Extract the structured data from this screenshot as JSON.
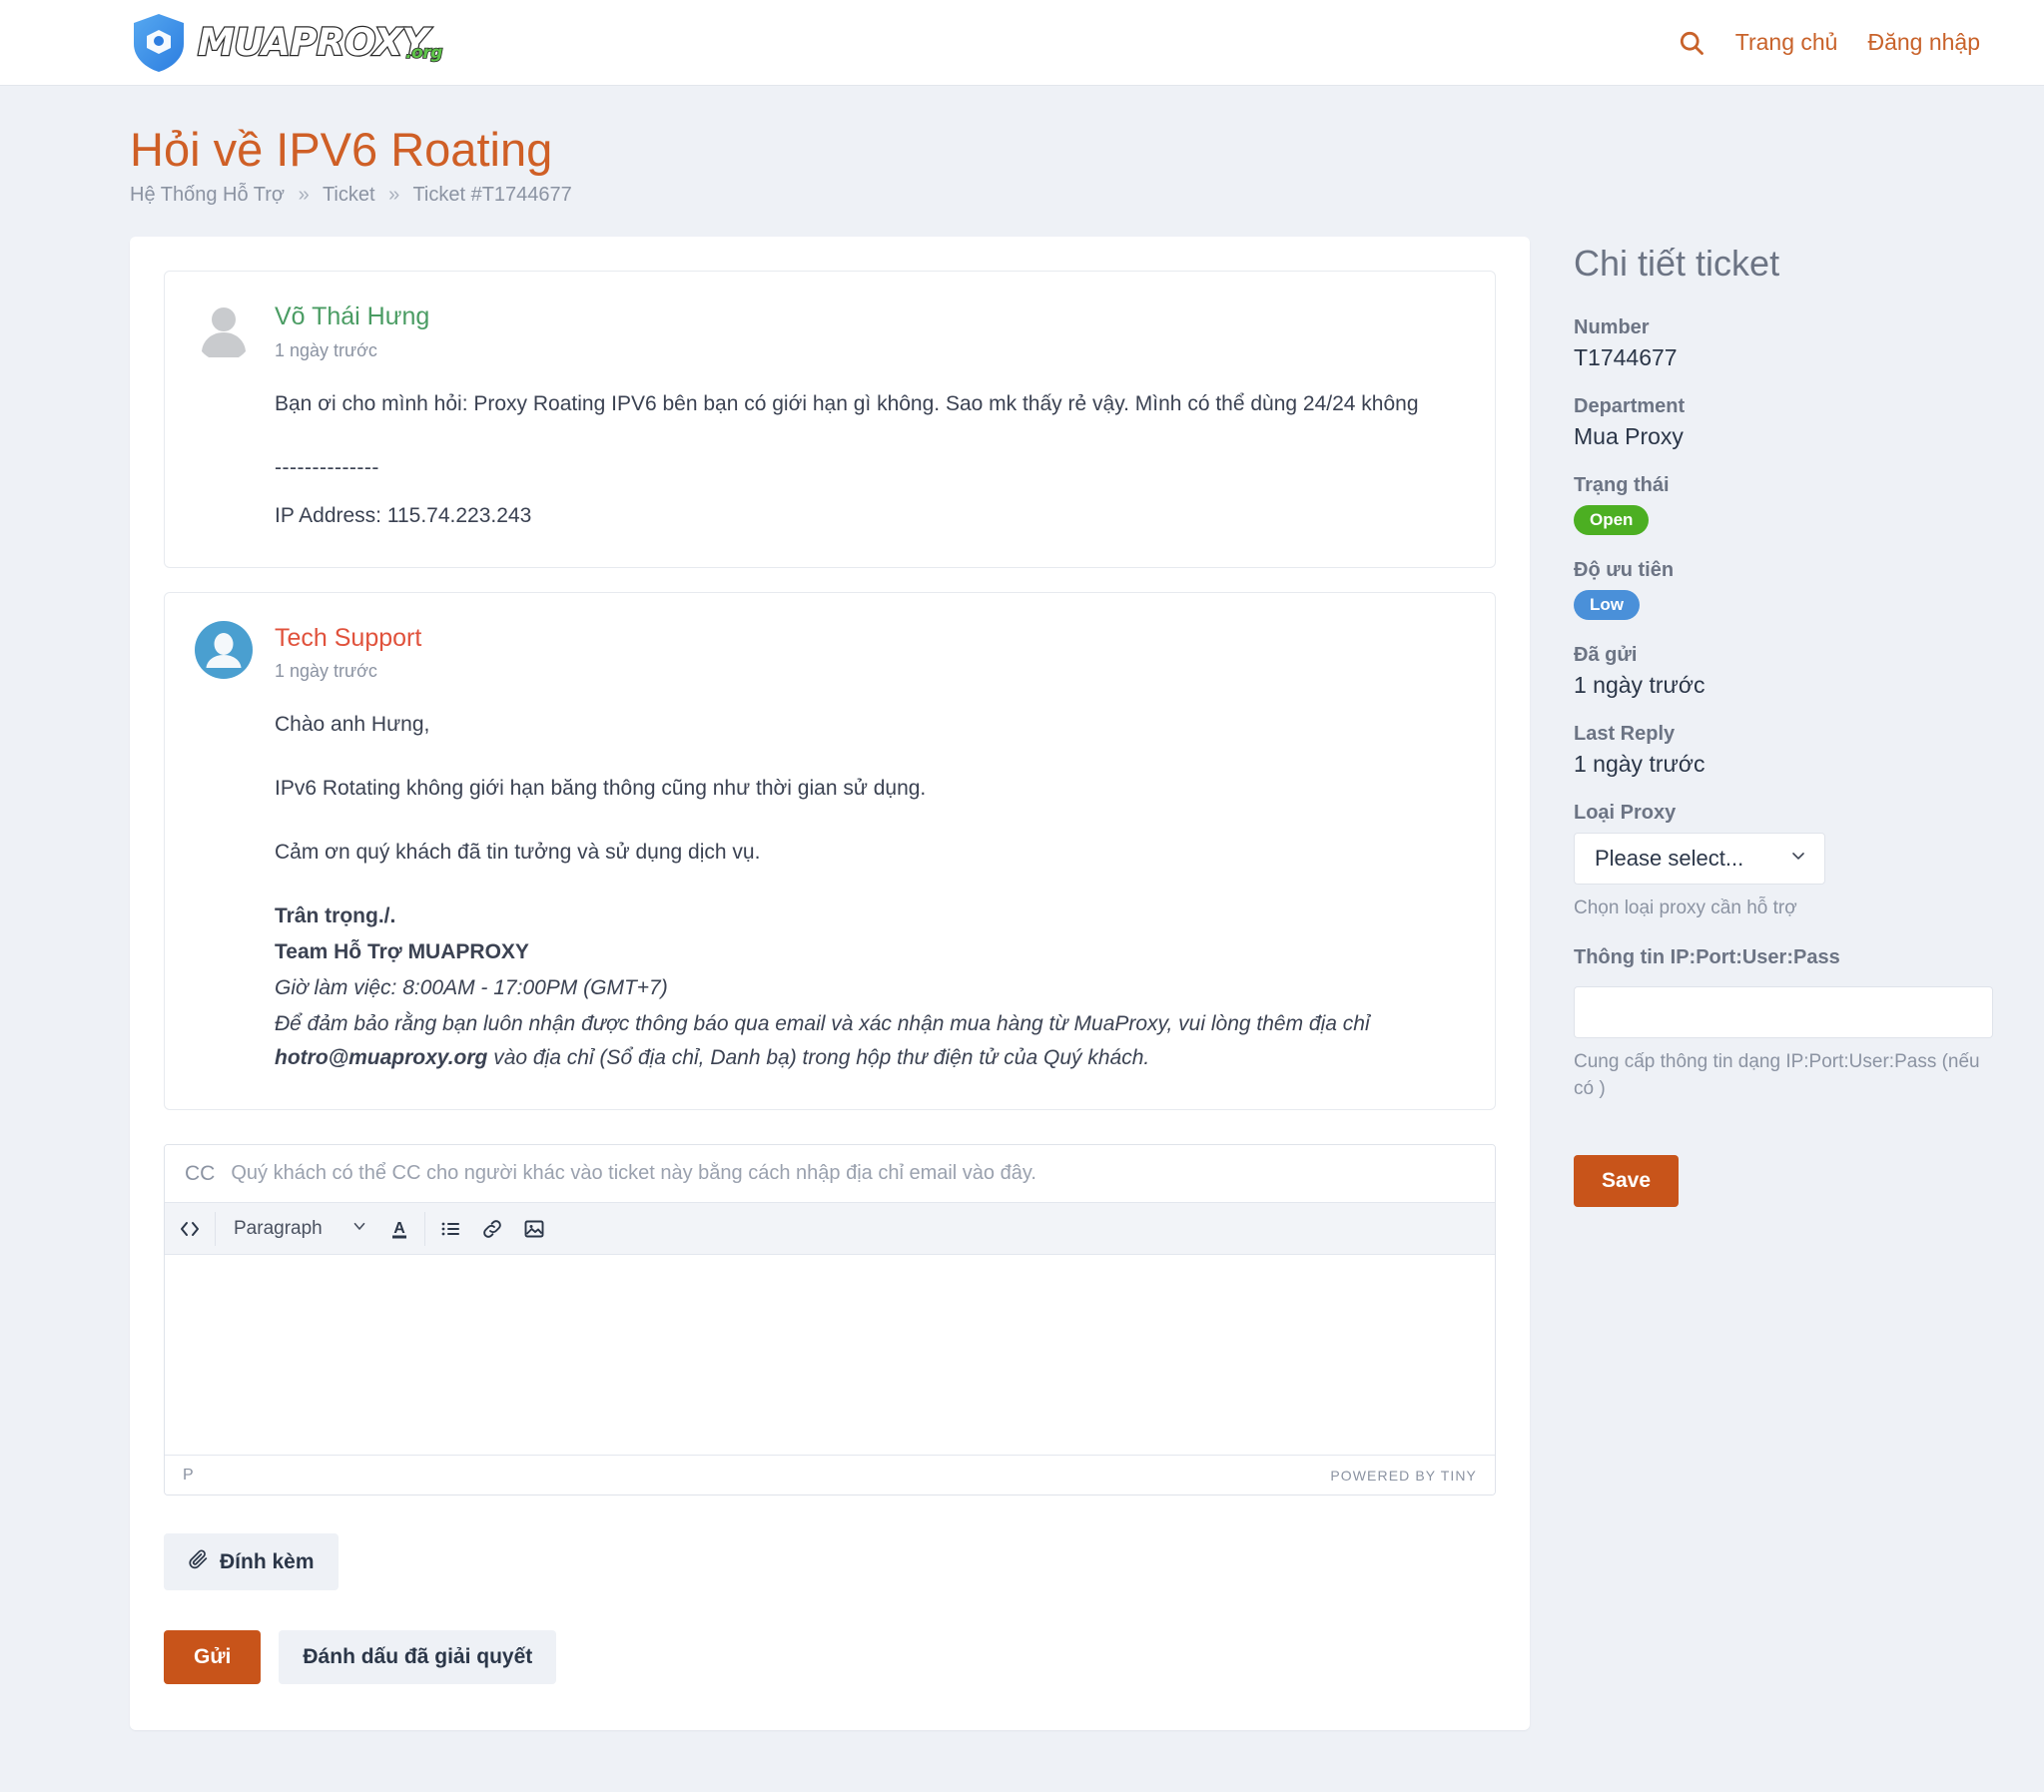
{
  "header": {
    "brand": {
      "name": "MUAPROXY",
      "tld": ".org"
    },
    "search_icon": "search-icon",
    "nav": [
      {
        "label": "Trang chủ"
      },
      {
        "label": "Đăng nhập"
      }
    ]
  },
  "page": {
    "title": "Hỏi về IPV6 Roating",
    "breadcrumb": [
      {
        "label": "Hệ Thống Hỗ Trợ"
      },
      {
        "label": "Ticket"
      },
      {
        "label": "Ticket #T1744677"
      }
    ],
    "breadcrumb_separator": "»"
  },
  "messages": [
    {
      "author": "Võ Thái Hưng",
      "time": "1 ngày trước",
      "avatar": "user-avatar-gray",
      "body_line1": "Bạn ơi cho mình hỏi: Proxy Roating IPV6 bên bạn có giới hạn gì không. Sao mk thấy rẻ vậy. Mình có thể dùng 24/24 không",
      "divider": "--------------",
      "ip_line": "IP Address: 115.74.223.243"
    },
    {
      "author": "Tech Support",
      "time": "1 ngày trước",
      "avatar": "user-avatar-blue",
      "greeting": "Chào anh Hưng,",
      "para1": "IPv6 Rotating không giới hạn băng thông cũng như thời gian sử dụng.",
      "para2": "Cảm ơn quý khách đã tin tưởng và sử dụng dịch vụ.",
      "sig_regards": "Trân trọng./.",
      "sig_team": "Team Hỗ Trợ MUAPROXY",
      "sig_hours": "Giờ làm việc: 8:00AM - 17:00PM (GMT+7)",
      "sig_note_a": "Để đảm bảo rằng bạn luôn nhận được thông báo qua email và xác nhận mua hàng từ MuaProxy, vui lòng thêm địa chỉ ",
      "sig_note_email": "hotro@muaproxy.org",
      "sig_note_b": " vào địa chỉ (Sổ địa chỉ, Danh bạ) trong hộp thư điện tử của Quý khách."
    }
  ],
  "reply": {
    "cc_label": "CC",
    "cc_value": "",
    "cc_placeholder": "Quý khách có thể CC cho người khác vào ticket này bằng cách nhập địa chỉ email vào đây.",
    "toolbar": {
      "source_code_icon": "source-code-icon",
      "block_format": "Paragraph",
      "chevron_icon": "chevron-down-icon",
      "text_color_icon": "text-color-icon",
      "bullet_list_icon": "bullet-list-icon",
      "link_icon": "link-icon",
      "image_icon": "image-icon"
    },
    "body_value": "",
    "status_path": "P",
    "powered_by": "POWERED BY TINY",
    "attach_icon": "paperclip-icon",
    "attach_label": "Đính kèm",
    "submit_label": "Gửi",
    "resolve_label": "Đánh dấu đã giải quyết"
  },
  "sidebar": {
    "title": "Chi tiết ticket",
    "number_label": "Number",
    "number_value": "T1744677",
    "department_label": "Department",
    "department_value": "Mua Proxy",
    "status_label": "Trạng thái",
    "status_value": "Open",
    "priority_label": "Độ ưu tiên",
    "priority_value": "Low",
    "submitted_label": "Đã gửi",
    "submitted_value": "1 ngày trước",
    "last_reply_label": "Last Reply",
    "last_reply_value": "1 ngày trước",
    "proxy_type_label": "Loại Proxy",
    "proxy_type_selected": "Please select...",
    "proxy_type_help": "Chọn loại proxy cần hỗ trợ",
    "ipinfo_label": "Thông tin IP:Port:User:Pass",
    "ipinfo_value": "",
    "ipinfo_help": "Cung cấp thông tin dạng IP:Port:User:Pass (nếu có )",
    "save_label": "Save"
  },
  "colors": {
    "accent_orange": "#c8541a",
    "nav_link": "#c8622a",
    "title_orange": "#cf5f26",
    "status_open_green": "#4caf22",
    "priority_low_blue": "#4a90d9",
    "customer_green": "#4a9c63",
    "agent_red": "#e0523c",
    "page_bg": "#eef1f6"
  }
}
